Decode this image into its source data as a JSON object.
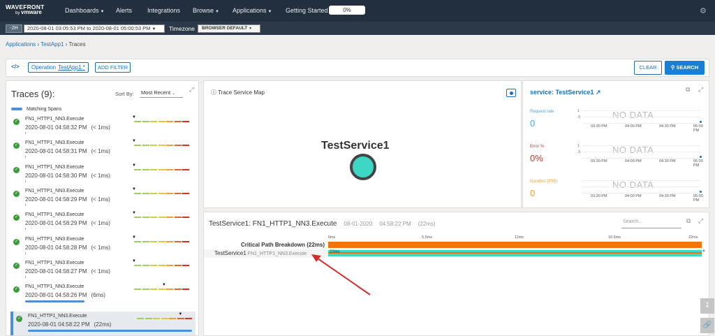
{
  "nav": {
    "brand_top": "WAVEFRONT",
    "brand_by": "by",
    "brand_vmware": "vmware",
    "items": [
      {
        "label": "Dashboards",
        "caret": true
      },
      {
        "label": "Alerts",
        "caret": false
      },
      {
        "label": "Integrations",
        "caret": false
      },
      {
        "label": "Browse",
        "caret": true
      },
      {
        "label": "Applications",
        "caret": true
      },
      {
        "label": "Getting Started",
        "caret": false
      }
    ],
    "progress": "0%",
    "settings_icon": "gear-icon"
  },
  "timebar": {
    "preset": "-2H",
    "range_from": "2020-08-01 03:05:53 PM",
    "range_to_word": "to",
    "range_to": "2020-08-01 05:00:53 PM",
    "timezone_label": "Timezone",
    "timezone_value": "BROWSER DEFAULT"
  },
  "breadcrumb": {
    "app": "Applications",
    "sep": " › ",
    "service": "TestApp1",
    "page": "Traces"
  },
  "filters": {
    "code_toggle": "</>",
    "operation_label": "Operation",
    "operation_value": "TestApp1.*",
    "add_filter": "ADD FILTER",
    "clear": "CLEAR",
    "search": "SEARCH"
  },
  "traces": {
    "title": "Traces (9):",
    "sort_label": "Sort By:",
    "sort_value": "Most Recent",
    "legend": "Matching Spans",
    "rows": [
      {
        "name": "FN1_HTTP1_NN3.Execute",
        "time": "2020-08-01 04:58:32 PM",
        "duration": "(< 1ms)",
        "marker_pos": 0.0
      },
      {
        "name": "FN1_HTTP1_NN3.Execute",
        "time": "2020-08-01 04:58:31 PM",
        "duration": "(< 1ms)",
        "marker_pos": 0.0
      },
      {
        "name": "FN1_HTTP1_NN3.Execute",
        "time": "2020-08-01 04:58:30 PM",
        "duration": "(< 1ms)",
        "marker_pos": 0.0
      },
      {
        "name": "FN1_HTTP1_NN3.Execute",
        "time": "2020-08-01 04:58:29 PM",
        "duration": "(< 1ms)",
        "marker_pos": 0.0
      },
      {
        "name": "FN1_HTTP1_NN3.Execute",
        "time": "2020-08-01 04:58:29 PM",
        "duration": "(< 1ms)",
        "marker_pos": 0.0
      },
      {
        "name": "FN1_HTTP1_NN3.Execute",
        "time": "2020-08-01 04:58:28 PM",
        "duration": "(< 1ms)",
        "marker_pos": 0.0
      },
      {
        "name": "FN1_HTTP1_NN3.Execute",
        "time": "2020-08-01 04:58:27 PM",
        "duration": "(< 1ms)",
        "marker_pos": 0.0
      },
      {
        "name": "FN1_HTTP1_NN3.Execute",
        "time": "2020-08-01 04:58:26 PM",
        "duration": "(6ms)",
        "marker_pos": 0.55,
        "match_fraction": 0.36
      },
      {
        "name": "FN1_HTTP1_NN3.Execute",
        "time": "2020-08-01 04:58:22 PM",
        "duration": "(22ms)",
        "marker_pos": 0.8,
        "match_fraction": 1.0,
        "selected": true
      }
    ],
    "spark_colors": [
      "#9ecf5e",
      "#9ecf5e",
      "#c8d23c",
      "#e8c53a",
      "#f0a030",
      "#e8622c",
      "#d83020"
    ]
  },
  "service_map": {
    "title": "Trace Service Map",
    "node_label": "TestService1",
    "node_color": "#3ed6c5"
  },
  "service_panel": {
    "title": "service: TestService1",
    "metrics": [
      {
        "label": "Request rate",
        "value": "0",
        "color": "#4aa3df",
        "y_ticks": [
          "1",
          ".5"
        ]
      },
      {
        "label": "Error %",
        "value": "0%",
        "color": "#c0392b",
        "y_ticks": [
          "1",
          ".5"
        ]
      },
      {
        "label": "Duration (P95)",
        "value": "0",
        "color": "#f0a030",
        "y_ticks": []
      }
    ],
    "no_data": "NO DATA",
    "x_ticks": [
      "03:30 PM",
      "04:00 PM",
      "04:30 PM",
      "05:00 PM"
    ]
  },
  "trace_detail": {
    "title": "TestService1: FN1_HTTP1_NN3.Execute",
    "date": "08-01-2020",
    "time": "04:58:22 PM",
    "duration": "(22ms)",
    "search_placeholder": "Search...",
    "ruler": [
      "0ms",
      "5.5ms",
      "11ms",
      "16.5ms",
      "22ms"
    ],
    "critical_path": "Critical Path Breakdown (22ms)",
    "service": "TestService1",
    "operation": "FN1_HTTP1_NN3.Execute",
    "span_label": "22ms"
  }
}
